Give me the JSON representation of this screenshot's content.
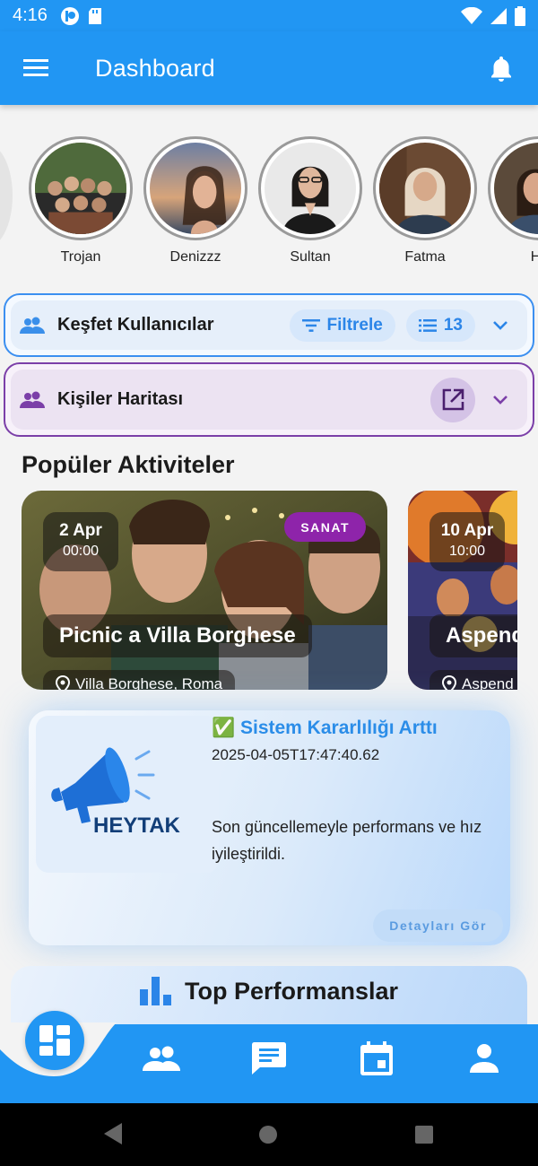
{
  "status_bar": {
    "time": "4:16"
  },
  "app_bar": {
    "title": "Dashboard",
    "menu_icon": "menu-icon",
    "notification_icon": "bell-icon"
  },
  "stories": [
    {
      "name": "Trojan"
    },
    {
      "name": "Denizzz"
    },
    {
      "name": "Sultan"
    },
    {
      "name": "Fatma"
    },
    {
      "name": "Ha"
    }
  ],
  "discover_users": {
    "label": "Keşfet Kullanıcılar",
    "filter_label": "Filtrele",
    "count": "13"
  },
  "people_map": {
    "label": "Kişiler Haritası"
  },
  "popular": {
    "title": "Popüler Aktiviteler",
    "cards": [
      {
        "day": "2 Apr",
        "time": "00:00",
        "category": "SANAT",
        "title": "Picnic a Villa Borghese",
        "location": "Villa Borghese, Roma"
      },
      {
        "day": "10 Apr",
        "time": "10:00",
        "category": "",
        "title": "Aspend",
        "location": "Aspend"
      }
    ]
  },
  "announcement": {
    "brand": "HEYTAK",
    "title": "✅ Sistem Kararlılığı Arttı",
    "timestamp": "2025-04-05T17:47:40.62",
    "body": "Son güncellemeyle performans ve hız iyileştirildi.",
    "details_label": "Detayları Gör"
  },
  "top_performers": {
    "title": "Top Performanslar"
  },
  "colors": {
    "primary": "#2196f3",
    "category_badge": "#8e24aa",
    "map_accent": "#7b3fa8"
  }
}
